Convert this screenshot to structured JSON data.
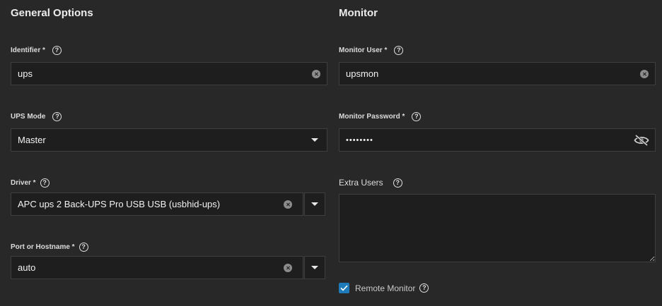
{
  "general": {
    "title": "General Options",
    "identifier": {
      "label": "Identifier *",
      "value": "ups"
    },
    "ups_mode": {
      "label": "UPS Mode",
      "value": "Master"
    },
    "driver": {
      "label": "Driver *",
      "value": "APC ups 2 Back-UPS Pro USB USB (usbhid-ups)"
    },
    "port": {
      "label": "Port or Hostname *",
      "value": "auto"
    }
  },
  "monitor": {
    "title": "Monitor",
    "user": {
      "label": "Monitor User *",
      "value": "upsmon"
    },
    "password": {
      "label": "Monitor Password *",
      "value": "••••••••"
    },
    "extra_users": {
      "label": "Extra Users",
      "value": ""
    },
    "remote_monitor": {
      "label": "Remote Monitor",
      "checked": true
    }
  },
  "help_glyph": "?",
  "colors": {
    "accent": "#1e7ab8",
    "background": "#282828",
    "field": "#1e1e1e"
  }
}
